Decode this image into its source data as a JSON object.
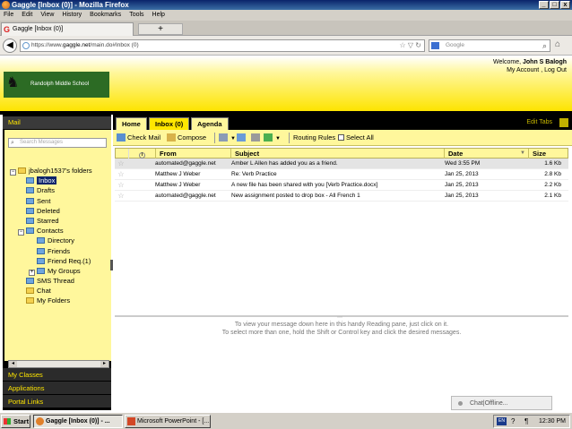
{
  "window": {
    "title": "Gaggle [Inbox (0)] - Mozilla Firefox",
    "controls": [
      "_",
      "□",
      "x"
    ]
  },
  "menu": [
    "File",
    "Edit",
    "View",
    "History",
    "Bookmarks",
    "Tools",
    "Help"
  ],
  "browser_tab": {
    "label": "Gaggle [Inbox (0)]",
    "new_tab": "+"
  },
  "url": {
    "prefix": "https://www.",
    "domain": "gaggle.net",
    "path": "/main.do#Inbox (0)"
  },
  "search": {
    "placeholder": "Google"
  },
  "header": {
    "school": "Randolph Middle School",
    "welcome": "Welcome,",
    "user": "John S Balogh",
    "links": "My Account , Log Out"
  },
  "sidebar": {
    "heading": "Mail",
    "search_placeholder": "Search Messages",
    "root": "jbalogh1537's folders",
    "folders": {
      "inbox": "Inbox",
      "drafts": "Drafts",
      "sent": "Sent",
      "deleted": "Deleted",
      "starred": "Starred",
      "contacts": "Contacts",
      "directory": "Directory",
      "friends": "Friends",
      "friend_req": "Friend Req.(1)",
      "my_groups": "My Groups",
      "sms": "SMS Thread",
      "chat": "Chat",
      "my_folders": "My Folders"
    },
    "links": [
      "My Classes",
      "Applications",
      "Portal Links"
    ]
  },
  "tabs": {
    "home": "Home",
    "inbox": "Inbox (0)",
    "agenda": "Agenda",
    "edit": "Edit Tabs"
  },
  "toolbar": {
    "check_mail": "Check Mail",
    "compose": "Compose",
    "routing_rules": "Routing Rules",
    "select_all": "Select All"
  },
  "grid": {
    "headers": {
      "from": "From",
      "subject": "Subject",
      "date": "Date",
      "size": "Size"
    },
    "rows": [
      {
        "from": "automated@gaggle.net",
        "subject": "Amber L Allen has added you as a friend.",
        "date": "Wed 3:55 PM",
        "size": "1.6 Kb"
      },
      {
        "from": "Matthew J Weber",
        "subject": "Re: Verb Practice",
        "date": "Jan 25, 2013",
        "size": "2.8 Kb"
      },
      {
        "from": "Matthew J Weber",
        "subject": "A new file has been shared with you [Verb Practice.docx]",
        "date": "Jan 25, 2013",
        "size": "2.2 Kb"
      },
      {
        "from": "automated@gaggle.net",
        "subject": "New assignment posted to drop box - All French 1",
        "date": "Jan 25, 2013",
        "size": "2.1 Kb"
      }
    ]
  },
  "reading_pane": {
    "line1": "To view your message down here in this handy Reading pane, just click on it.",
    "line2": "To select more than one, hold the Shift or Control key and click the desired messages."
  },
  "chat": {
    "status": "Chat|Offline..."
  },
  "taskbar": {
    "start": "Start",
    "tasks": [
      "Gaggle [Inbox (0)] - ...",
      "Microsoft PowerPoint - [..."
    ],
    "lang": "EN",
    "time": "12:30 PM"
  },
  "colors": {
    "accent_yellow": "#ffe600",
    "pale_yellow": "#fff79c",
    "title_blue": "#0a246a",
    "school_green": "#2c6b24"
  }
}
